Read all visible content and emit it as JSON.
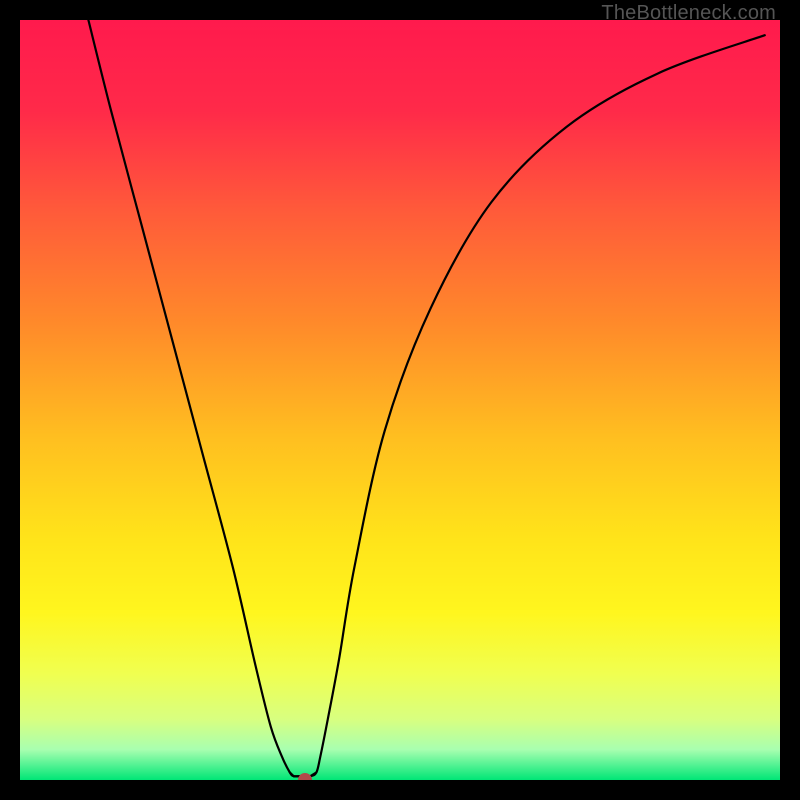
{
  "watermark": "TheBottleneck.com",
  "chart_data": {
    "type": "line",
    "title": "",
    "xlabel": "",
    "ylabel": "",
    "xlim": [
      0,
      100
    ],
    "ylim": [
      0,
      100
    ],
    "gradient_stops": [
      {
        "pos": 0.0,
        "color": "#ff1a4d"
      },
      {
        "pos": 0.12,
        "color": "#ff2a49"
      },
      {
        "pos": 0.25,
        "color": "#ff5a3a"
      },
      {
        "pos": 0.4,
        "color": "#ff8a2a"
      },
      {
        "pos": 0.55,
        "color": "#ffbf20"
      },
      {
        "pos": 0.68,
        "color": "#ffe31a"
      },
      {
        "pos": 0.78,
        "color": "#fff61e"
      },
      {
        "pos": 0.86,
        "color": "#f0ff50"
      },
      {
        "pos": 0.92,
        "color": "#d8ff80"
      },
      {
        "pos": 0.96,
        "color": "#a8ffb0"
      },
      {
        "pos": 1.0,
        "color": "#00e676"
      }
    ],
    "series": [
      {
        "name": "bottleneck-curve",
        "x": [
          9,
          12,
          16,
          20,
          24,
          28,
          31,
          33,
          34.5,
          35.5,
          36,
          36.8,
          38.2,
          39,
          39.5,
          40.5,
          42,
          44,
          48,
          54,
          62,
          72,
          84,
          98
        ],
        "y": [
          100,
          88,
          73,
          58,
          43,
          28,
          15,
          7,
          3,
          1,
          0.5,
          0.5,
          0.5,
          1,
          3,
          8,
          16,
          28,
          46,
          62,
          76,
          86,
          93,
          98
        ]
      }
    ],
    "marker": {
      "x": 37.5,
      "y": 0.0,
      "color": "#b24a4a",
      "r": 7
    }
  }
}
